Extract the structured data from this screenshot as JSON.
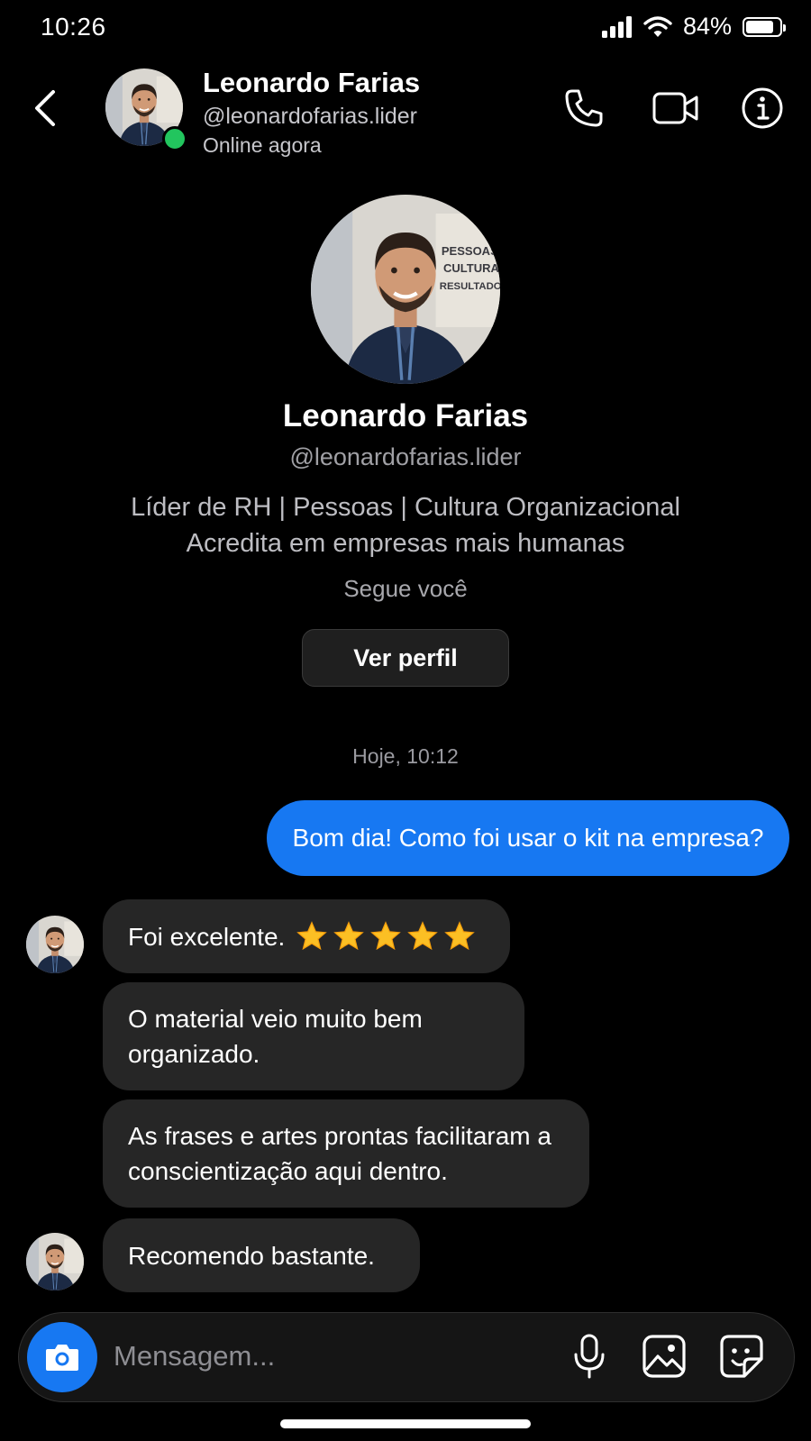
{
  "status_bar": {
    "time": "10:26",
    "battery_percent": "84%",
    "battery_level": 0.84
  },
  "header": {
    "name": "Leonardo Farias",
    "handle": "@leonardofarias.lider",
    "status": "Online agora",
    "icons": [
      "back-chevron-icon",
      "phone-icon",
      "video-camera-icon",
      "info-icon"
    ]
  },
  "profile": {
    "name": "Leonardo Farias",
    "handle": "@leonardofarias.lider",
    "bio_line1": "Líder de RH | Pessoas | Cultura Organizacional",
    "bio_line2": "Acredita em empresas mais humanas",
    "follows": "Segue você",
    "view_profile_label": "Ver perfil",
    "avatar_sign_lines": [
      "PESSOAS",
      "CULTURA",
      "RESULTADOS"
    ]
  },
  "conversation": {
    "timestamp": "Hoje, 10:12",
    "messages": [
      {
        "sender": "me",
        "text": "Bom dia! Como foi usar o kit na empresa?"
      },
      {
        "sender": "them",
        "text": "Foi excelente.",
        "stars": 5
      },
      {
        "sender": "them",
        "text": "O material veio muito bem organizado."
      },
      {
        "sender": "them",
        "text": "As frases e artes prontas facilitaram a conscientização aqui dentro."
      },
      {
        "sender": "them",
        "text": "Recomendo bastante."
      }
    ]
  },
  "composer": {
    "placeholder": "Mensagem...",
    "icons": [
      "camera-icon",
      "microphone-icon",
      "gallery-icon",
      "sticker-icon"
    ]
  },
  "colors": {
    "accent": "#1778f2",
    "online": "#22c55e",
    "incoming_bubble": "#262626"
  }
}
